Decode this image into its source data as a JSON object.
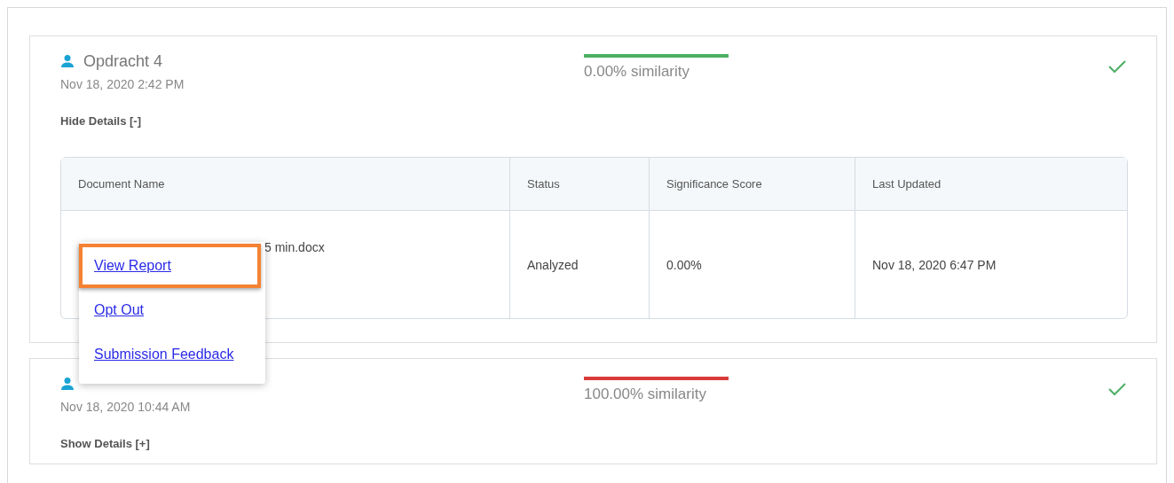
{
  "submissions": [
    {
      "title": "Opdracht 4",
      "date": "Nov 18, 2020 2:42 PM",
      "details_toggle": "Hide Details [-]",
      "similarity": "0.00% similarity",
      "color": "#4caf64",
      "complete": true,
      "table": {
        "columns": [
          "Document Name",
          "Status",
          "Significance Score",
          "Last Updated"
        ],
        "rows": [
          [
            "5 min.docx",
            "Analyzed",
            "0.00%",
            "Nov 18, 2020 6:47 PM"
          ]
        ]
      }
    },
    {
      "date": "Nov 18, 2020 10:44 AM",
      "details_toggle": "Show Details [+]",
      "similarity": "100.00% similarity",
      "color": "#d93a3a",
      "complete": true
    }
  ],
  "menu": {
    "items": [
      {
        "label": "View Report",
        "highlighted": true
      },
      {
        "label": "Opt Out",
        "highlighted": false
      },
      {
        "label": "Submission Feedback",
        "highlighted": false
      }
    ]
  }
}
